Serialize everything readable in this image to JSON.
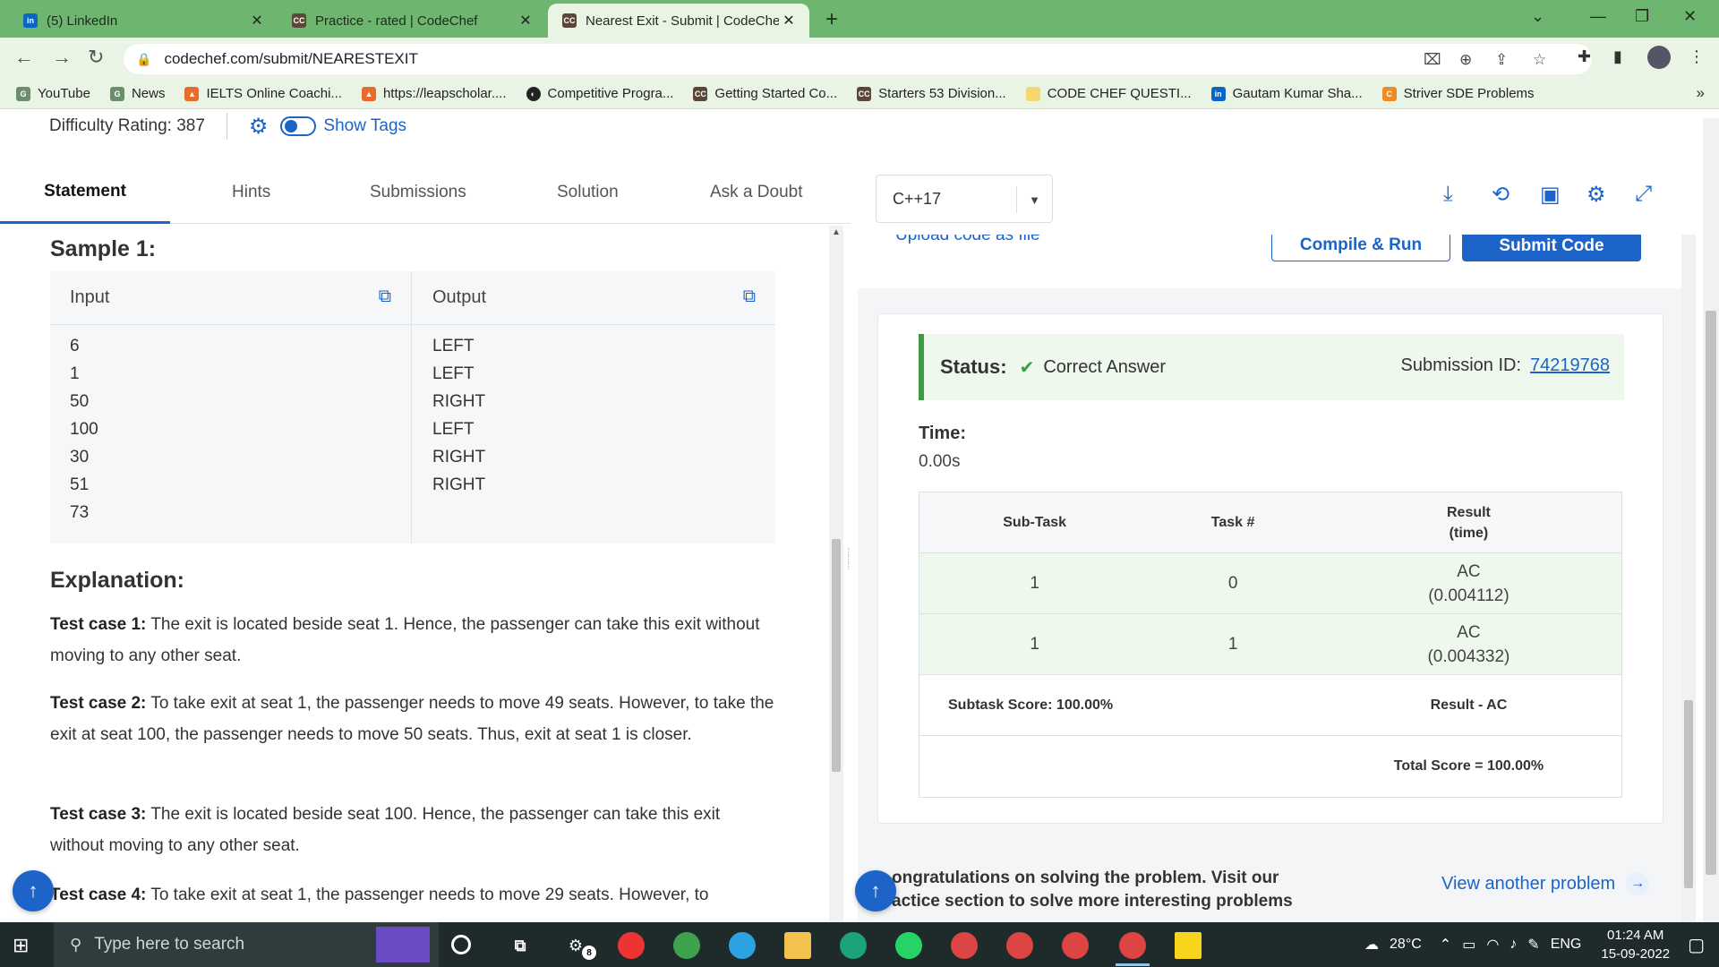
{
  "browser": {
    "tabs": [
      {
        "title": "(5) LinkedIn",
        "icon": "linkedin-icon",
        "active": false
      },
      {
        "title": "Practice - rated | CodeChef",
        "icon": "codechef-icon",
        "active": false
      },
      {
        "title": "Nearest Exit - Submit | CodeChef",
        "icon": "codechef-icon",
        "active": true
      }
    ],
    "url": "codechef.com/submit/NEARESTEXIT",
    "bookmarks": [
      {
        "label": "YouTube",
        "icon": "youtube-icon"
      },
      {
        "label": "News",
        "icon": "news-icon"
      },
      {
        "label": "IELTS Online Coachi...",
        "icon": "leapscholar-icon"
      },
      {
        "label": "https://leapscholar....",
        "icon": "leapscholar-icon"
      },
      {
        "label": "Competitive Progra...",
        "icon": "globe-icon"
      },
      {
        "label": "Getting Started Co...",
        "icon": "codechef-icon"
      },
      {
        "label": "Starters 53 Division...",
        "icon": "codechef-icon"
      },
      {
        "label": "CODE CHEF QUESTI...",
        "icon": "folder-icon"
      },
      {
        "label": "Gautam Kumar Sha...",
        "icon": "linkedin-icon"
      },
      {
        "label": "Striver SDE Problems",
        "icon": "codestudio-icon"
      }
    ]
  },
  "problem": {
    "difficulty": "Difficulty Rating: 387",
    "show_tags": "Show Tags"
  },
  "left_tabs": [
    "Statement",
    "Hints",
    "Submissions",
    "Solution",
    "Ask a Doubt"
  ],
  "sample": {
    "title": "Sample 1:",
    "input_header": "Input",
    "output_header": "Output",
    "input_lines": [
      "6",
      "1",
      "50",
      "100",
      "30",
      "51",
      "73"
    ],
    "output_lines": [
      "LEFT",
      "LEFT",
      "RIGHT",
      "LEFT",
      "RIGHT",
      "RIGHT"
    ]
  },
  "explanation": {
    "title": "Explanation:",
    "cases": [
      {
        "label": "Test case 1:",
        "text": "The exit is located beside seat 1. Hence, the passenger can take this exit without moving to any other seat."
      },
      {
        "label": "Test case 2:",
        "text": "To take exit at seat 1, the passenger needs to move 49 seats. However, to take the exit at seat 100, the passenger needs to move 50 seats. Thus, exit at seat 1 is closer."
      },
      {
        "label": "Test case 3:",
        "text": "The exit is located beside seat 100. Hence, the passenger can take this exit without moving to any other seat."
      },
      {
        "label": "Test case 4:",
        "text": "To take exit at seat 1, the passenger needs to move 29 seats. However, to"
      }
    ]
  },
  "editor": {
    "language": "C++17",
    "upload_label": "Upload code as file",
    "compile_label": "Compile & Run",
    "submit_label": "Submit Code"
  },
  "result": {
    "status_label": "Status:",
    "status_value": "Correct Answer",
    "submission_label": "Submission ID:",
    "submission_id": "74219768",
    "time_label": "Time:",
    "time_value": "0.00s",
    "table_headers": {
      "subtask": "Sub-Task",
      "task": "Task #",
      "result_line1": "Result",
      "result_line2": "(time)"
    },
    "rows": [
      {
        "subtask": "1",
        "task": "0",
        "result": "AC",
        "time": "(0.004112)"
      },
      {
        "subtask": "1",
        "task": "1",
        "result": "AC",
        "time": "(0.004332)"
      }
    ],
    "subtask_score": "Subtask Score: 100.00%",
    "result_summary": "Result - AC",
    "total_score": "Total Score = 100.00%"
  },
  "footer": {
    "congrats_line1": "ongratulations on solving the problem. Visit our",
    "congrats_line2": "actice section to solve more interesting problems",
    "view_another": "View another problem"
  },
  "taskbar": {
    "search_placeholder": "Type here to search",
    "temperature": "28°C",
    "language": "ENG",
    "time": "01:24 AM",
    "date": "15-09-2022",
    "badge": "8"
  },
  "colors": {
    "accent": "#1c64c8",
    "success": "#3d9a45",
    "tabbar": "#6eb56f"
  }
}
